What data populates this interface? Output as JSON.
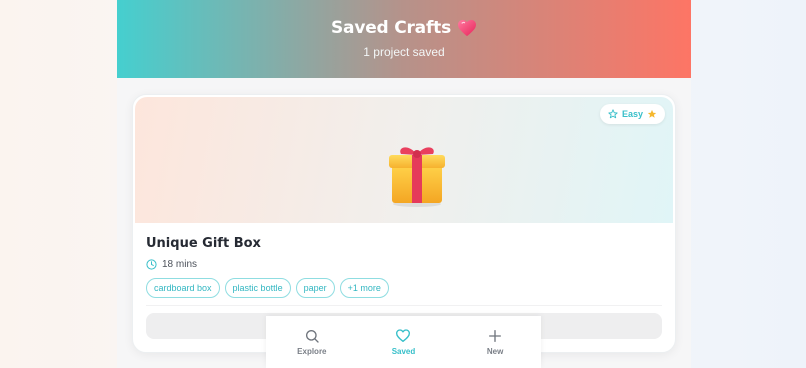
{
  "header": {
    "title": "Saved Crafts",
    "title_icon": "heart-emoji",
    "subtitle": "1 project saved"
  },
  "crafts": [
    {
      "title": "Unique Gift Box",
      "image_icon": "gift-emoji",
      "difficulty": "Easy",
      "time": "18 mins",
      "tags": [
        "cardboard box",
        "plastic bottle",
        "paper",
        "+1 more"
      ]
    }
  ],
  "nav": {
    "items": [
      {
        "label": "Explore",
        "icon": "search-icon",
        "active": false
      },
      {
        "label": "Saved",
        "icon": "heart-icon",
        "active": true
      },
      {
        "label": "New",
        "icon": "plus-icon",
        "active": false
      }
    ]
  },
  "colors": {
    "accent": "#36bfc9",
    "header_start": "#45cfcf",
    "header_end": "#fd7565"
  }
}
